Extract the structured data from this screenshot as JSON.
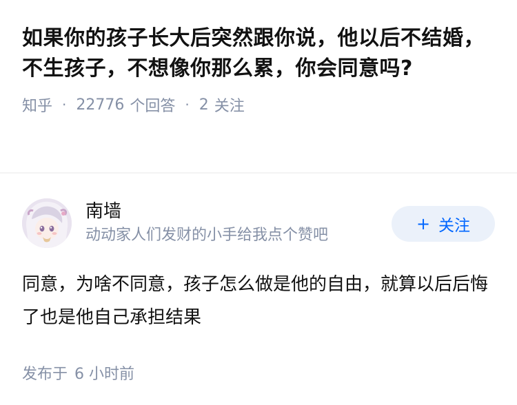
{
  "question": {
    "title": "如果你的孩子长大后突然跟你说，他以后不结婚，不生孩子，不想像你那么累，你会同意吗?",
    "source": "知乎",
    "answer_count": "22776",
    "answer_label": "个回答",
    "follower_count": "2",
    "follower_label": "关注",
    "separator": "·"
  },
  "answer": {
    "author_name": "南墙",
    "author_bio": "动动家人们发财的小手给我点个赞吧",
    "follow_button_label": "关注",
    "follow_button_icon": "plus-icon",
    "content": "同意，为啥不同意，孩子怎么做是他的自由，就算以后后悔了也是他自己承担结果",
    "posted_label": "发布于",
    "posted_time": "6 小时前"
  },
  "colors": {
    "accent": "#0066ff",
    "button_bg": "#ebf1fa",
    "muted_text": "#8590a6",
    "primary_text": "#121212",
    "divider": "#f3f3f3"
  }
}
